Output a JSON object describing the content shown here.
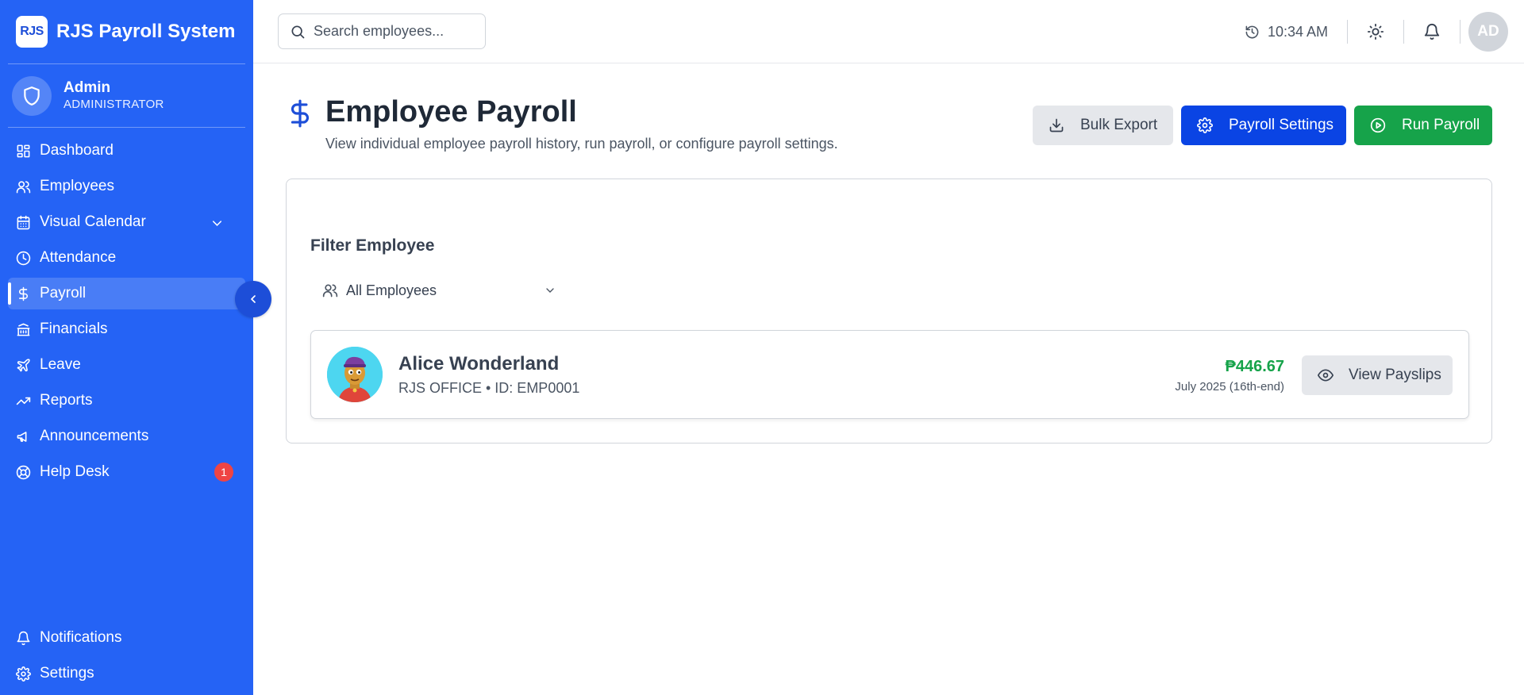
{
  "brand": {
    "logo_text": "RJS",
    "title": "RJS Payroll System"
  },
  "user": {
    "name": "Admin",
    "role": "ADMINISTRATOR",
    "icon": "shield-icon"
  },
  "nav": {
    "items": [
      {
        "label": "Dashboard",
        "icon": "dashboard-icon"
      },
      {
        "label": "Employees",
        "icon": "users-icon"
      },
      {
        "label": "Visual Calendar",
        "icon": "calendar-icon",
        "expandable": true
      },
      {
        "label": "Attendance",
        "icon": "clock-icon"
      },
      {
        "label": "Payroll",
        "icon": "dollar-icon",
        "active": true
      },
      {
        "label": "Financials",
        "icon": "bank-icon"
      },
      {
        "label": "Leave",
        "icon": "plane-icon"
      },
      {
        "label": "Reports",
        "icon": "trending-up-icon"
      },
      {
        "label": "Announcements",
        "icon": "megaphone-icon"
      },
      {
        "label": "Help Desk",
        "icon": "lifebuoy-icon",
        "badge": "1"
      }
    ],
    "bottom": [
      {
        "label": "Notifications",
        "icon": "bell-icon"
      },
      {
        "label": "Settings",
        "icon": "gear-icon"
      }
    ]
  },
  "header": {
    "search_placeholder": "Search employees...",
    "time": "10:34 AM",
    "avatar_initials": "AD"
  },
  "page": {
    "title": "Employee Payroll",
    "subtitle": "View individual employee payroll history, run payroll, or configure payroll settings.",
    "buttons": {
      "export": "Bulk Export",
      "settings": "Payroll Settings",
      "run": "Run Payroll"
    }
  },
  "filter": {
    "label": "Filter Employee",
    "selected": "All Employees"
  },
  "employees": [
    {
      "name": "Alice Wonderland",
      "meta": "RJS OFFICE • ID: EMP0001",
      "amount": "₱446.67",
      "period": "July 2025 (16th-end)",
      "action": "View Payslips"
    }
  ],
  "colors": {
    "sidebar": "#2563f5",
    "primary_button": "#0a44e4",
    "success": "#16a34a",
    "badge": "#ef4444"
  }
}
